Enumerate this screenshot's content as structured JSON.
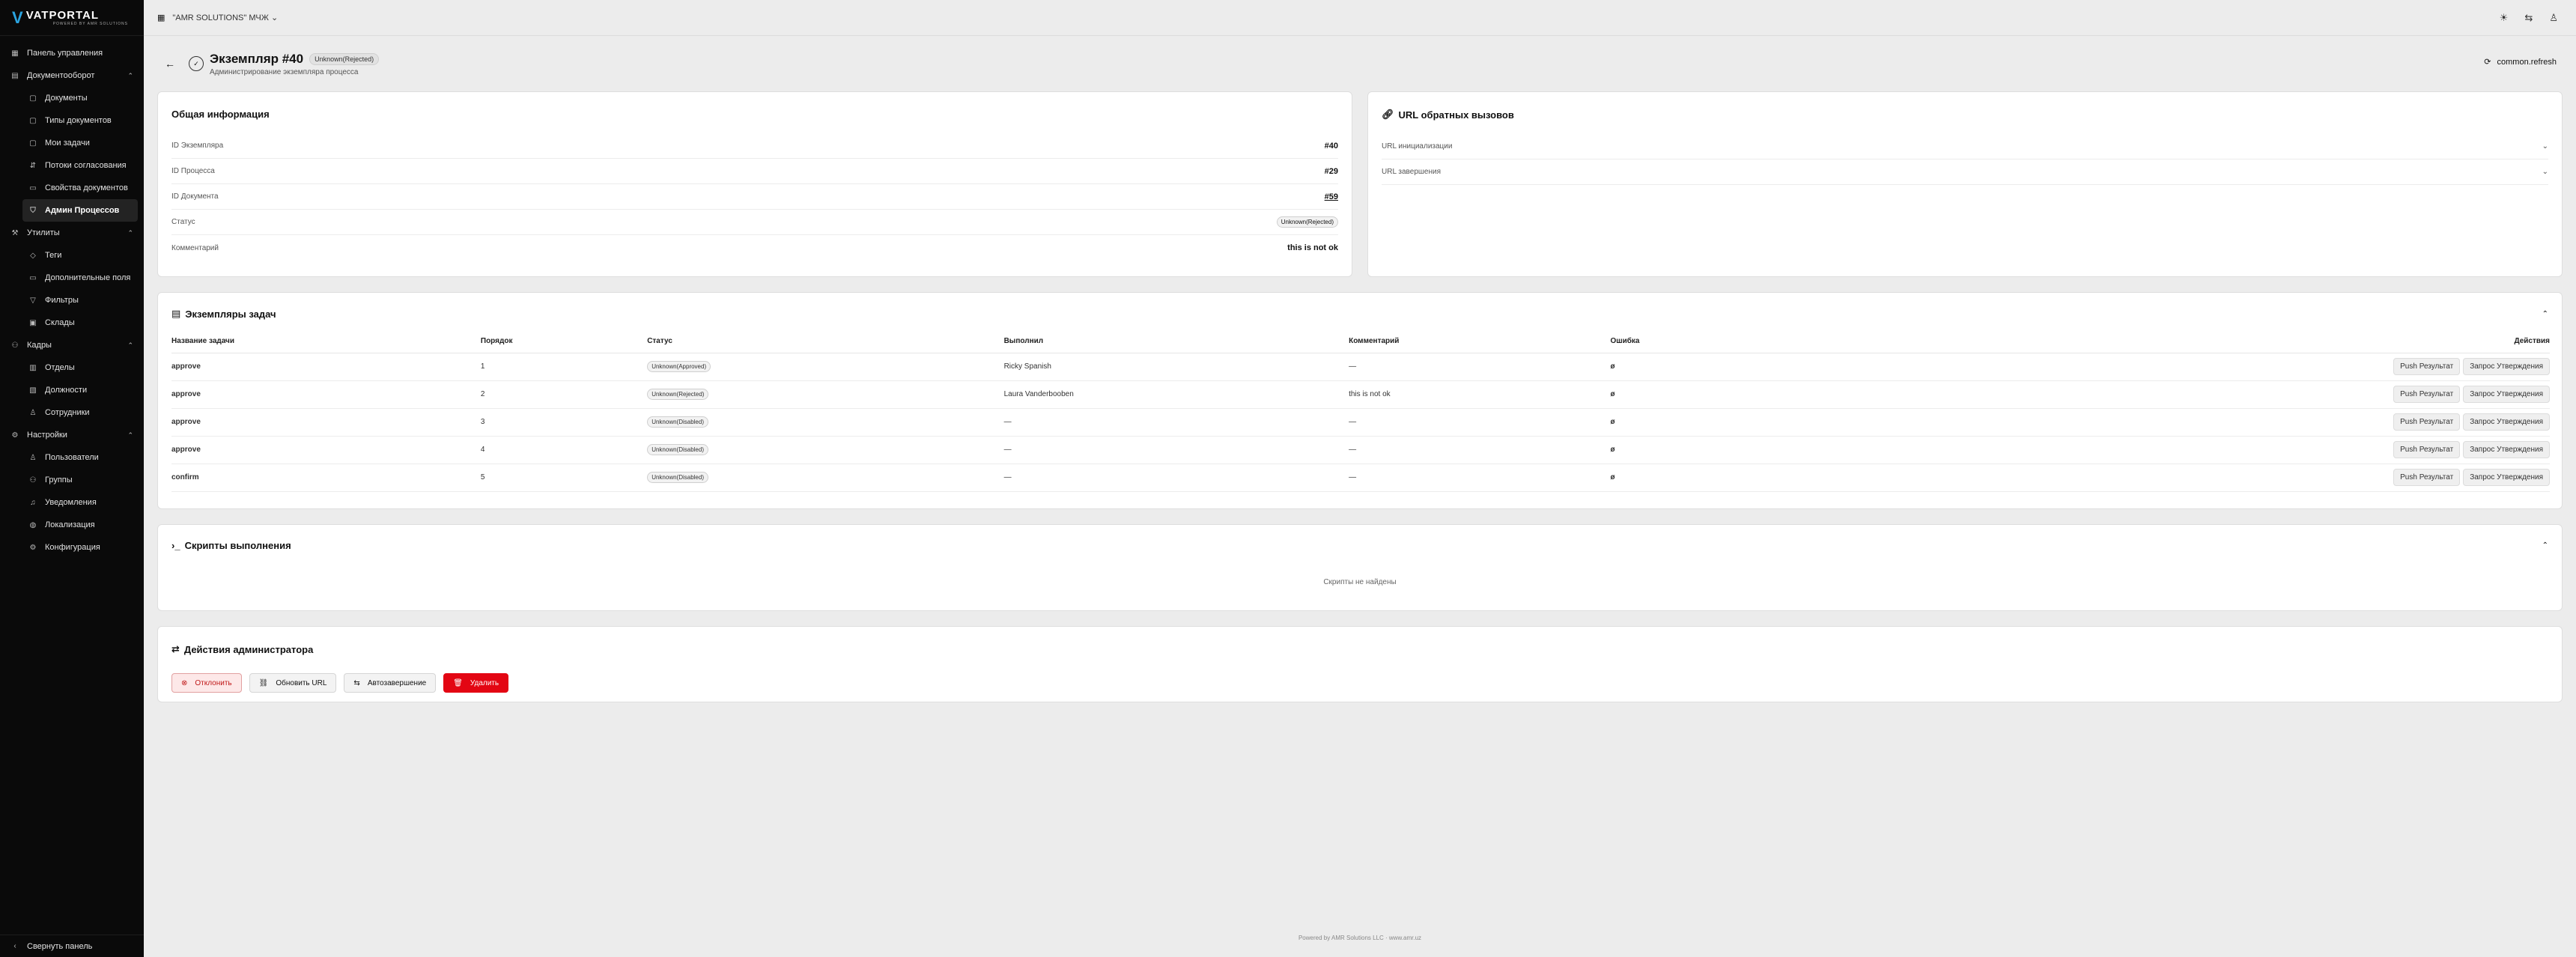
{
  "app": {
    "logo_mark": "V",
    "logo_title": "VATPORTAL",
    "logo_sub": "POWERED BY AMR SOLUTIONS"
  },
  "topbar": {
    "org": "\"AMR SOLUTIONS\" МЧЖ"
  },
  "sidebar": {
    "items": [
      {
        "label": "Панель управления",
        "icon": "dashboard-icon",
        "type": "top"
      },
      {
        "label": "Документооборот",
        "icon": "file-icon",
        "type": "group"
      },
      {
        "label": "Документы",
        "icon": "document-icon",
        "type": "sub"
      },
      {
        "label": "Типы документов",
        "icon": "document-icon",
        "type": "sub"
      },
      {
        "label": "Мои задачи",
        "icon": "document-icon",
        "type": "sub"
      },
      {
        "label": "Потоки согласования",
        "icon": "flow-icon",
        "type": "sub"
      },
      {
        "label": "Свойства документов",
        "icon": "inbox-icon",
        "type": "sub"
      },
      {
        "label": "Админ Процессов",
        "icon": "shield-icon",
        "type": "active"
      },
      {
        "label": "Утилиты",
        "icon": "wrench-icon",
        "type": "group"
      },
      {
        "label": "Теги",
        "icon": "tag-icon",
        "type": "sub"
      },
      {
        "label": "Дополнительные поля",
        "icon": "inbox-icon",
        "type": "sub"
      },
      {
        "label": "Фильтры",
        "icon": "filter-icon",
        "type": "sub"
      },
      {
        "label": "Склады",
        "icon": "warehouse-icon",
        "type": "sub"
      },
      {
        "label": "Кадры",
        "icon": "users-icon",
        "type": "group"
      },
      {
        "label": "Отделы",
        "icon": "building-icon",
        "type": "sub"
      },
      {
        "label": "Должности",
        "icon": "briefcase-icon",
        "type": "sub"
      },
      {
        "label": "Сотрудники",
        "icon": "user-icon",
        "type": "sub"
      },
      {
        "label": "Настройки",
        "icon": "gear-icon",
        "type": "group"
      },
      {
        "label": "Пользователи",
        "icon": "user-icon",
        "type": "sub"
      },
      {
        "label": "Группы",
        "icon": "users-icon",
        "type": "sub"
      },
      {
        "label": "Уведомления",
        "icon": "bell-icon",
        "type": "sub"
      },
      {
        "label": "Локализация",
        "icon": "globe-icon",
        "type": "sub"
      },
      {
        "label": "Конфигурация",
        "icon": "gear-icon",
        "type": "sub"
      }
    ],
    "collapse_label": "Свернуть панель"
  },
  "page": {
    "title": "Экземпляр #40",
    "status_badge": "Unknown(Rejected)",
    "subtitle": "Администрирование экземпляра процесса",
    "refresh_label": "common.refresh"
  },
  "info": {
    "title": "Общая информация",
    "rows": [
      {
        "k": "ID Экземпляра",
        "v": "#40"
      },
      {
        "k": "ID Процесса",
        "v": "#29"
      },
      {
        "k": "ID Документа",
        "v": "#59"
      },
      {
        "k": "Статус",
        "v": "Unknown(Rejected)"
      },
      {
        "k": "Комментарий",
        "v": "this is not ok"
      }
    ]
  },
  "urls": {
    "title": "URL обратных вызовов",
    "rows": [
      "URL инициализации",
      "URL завершения"
    ]
  },
  "tasks": {
    "title": "Экземпляры задач",
    "headers": [
      "Название задачи",
      "Порядок",
      "Статус",
      "Выполнил",
      "Комментарий",
      "Ошибка",
      "Действия"
    ],
    "rows": [
      {
        "name": "approve",
        "order": "1",
        "status": "Unknown(Approved)",
        "by": "Ricky Spanish",
        "comment": "—",
        "error": "ø"
      },
      {
        "name": "approve",
        "order": "2",
        "status": "Unknown(Rejected)",
        "by": "Laura Vanderbooben",
        "comment": "this is not ok",
        "error": "ø"
      },
      {
        "name": "approve",
        "order": "3",
        "status": "Unknown(Disabled)",
        "by": "—",
        "comment": "—",
        "error": "ø"
      },
      {
        "name": "approve",
        "order": "4",
        "status": "Unknown(Disabled)",
        "by": "—",
        "comment": "—",
        "error": "ø"
      },
      {
        "name": "confirm",
        "order": "5",
        "status": "Unknown(Disabled)",
        "by": "—",
        "comment": "—",
        "error": "ø"
      }
    ],
    "push_label": "Push Результат",
    "request_label": "Запрос Утверждения"
  },
  "scripts": {
    "title": "Скрипты выполнения",
    "empty": "Скрипты не найдены"
  },
  "admin": {
    "title": "Действия администратора",
    "reject": "Отклонить",
    "update_url": "Обновить URL",
    "auto_complete": "Автозавершение",
    "delete": "Удалить"
  },
  "footer": "Powered by AMR Solutions LLC · www.amr.uz"
}
